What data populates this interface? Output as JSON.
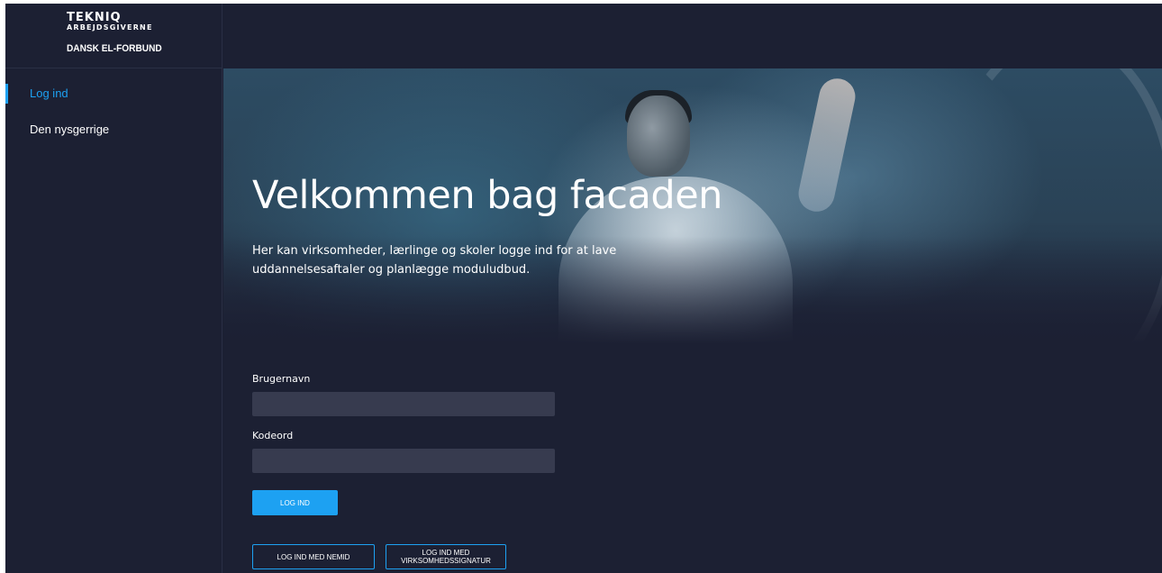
{
  "brand": {
    "tekniq": "TEKNIQ",
    "tekniq_sub": "ARBEJDSGIVERNE",
    "partner": "DANSK EL-FORBUND"
  },
  "sidebar": {
    "items": [
      {
        "label": "Log ind",
        "active": true
      },
      {
        "label": "Den nysgerrige",
        "active": false
      }
    ]
  },
  "hero": {
    "title": "Velkommen bag facaden",
    "text": "Her kan virksomheder, lærlinge og skoler logge ind for at lave uddannelsesaftaler og planlægge moduludbud."
  },
  "form": {
    "username_label": "Brugernavn",
    "username_value": "",
    "password_label": "Kodeord",
    "password_value": "",
    "login_button": "LOG IND",
    "nemid_button": "LOG IND MED NEMID",
    "signature_button_line1": "LOG IND MED",
    "signature_button_line2": "VIRKSOMHEDSSIGNATUR"
  },
  "colors": {
    "background": "#1c2033",
    "accent": "#1da1f2",
    "input": "#373b4f"
  }
}
